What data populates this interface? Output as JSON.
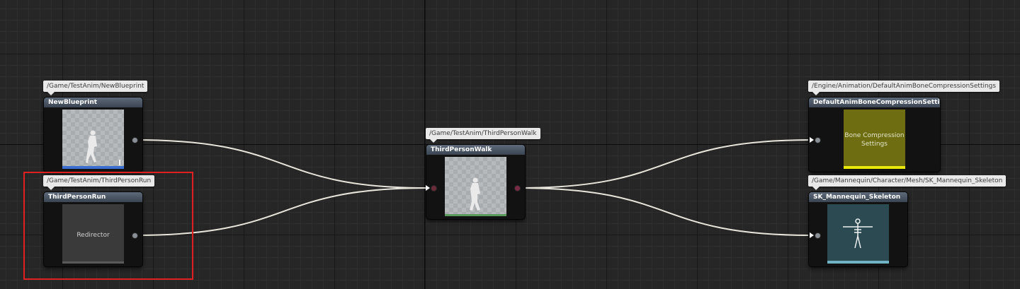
{
  "graph": {
    "selection_color": "#e02020",
    "wire_color": "#e8e6dc"
  },
  "nodes": {
    "new_blueprint": {
      "path": "/Game/TestAnim/NewBlueprint",
      "title": "NewBlueprint",
      "thumbnail": "mannequin-running",
      "bar_color": "#3a6fd0"
    },
    "third_person_run": {
      "path": "/Game/TestAnim/ThirdPersonRun",
      "title": "ThirdPersonRun",
      "thumbnail_text": "Redirector"
    },
    "third_person_walk": {
      "path": "/Game/TestAnim/ThirdPersonWalk",
      "title": "ThirdPersonWalk",
      "thumbnail": "mannequin-walking",
      "bar_color": "#5a9a5a"
    },
    "default_anim_bone_compression": {
      "path": "/Engine/Animation/DefaultAnimBoneCompressionSettings",
      "title": "DefaultAnimBoneCompressionSettings",
      "thumbnail_text": "Bone Compression Settings",
      "thumbnail_color": "#6e6d12",
      "bar_color": "#e8e80a"
    },
    "sk_mannequin_skeleton": {
      "path": "/Game/Mannequin/Character/Mesh/SK_Mannequin_Skeleton",
      "title": "SK_Mannequin_Skeleton",
      "thumbnail": "skeleton-icon",
      "thumbnail_color": "#2c4a52",
      "bar_color": "#6fb3c4"
    }
  }
}
